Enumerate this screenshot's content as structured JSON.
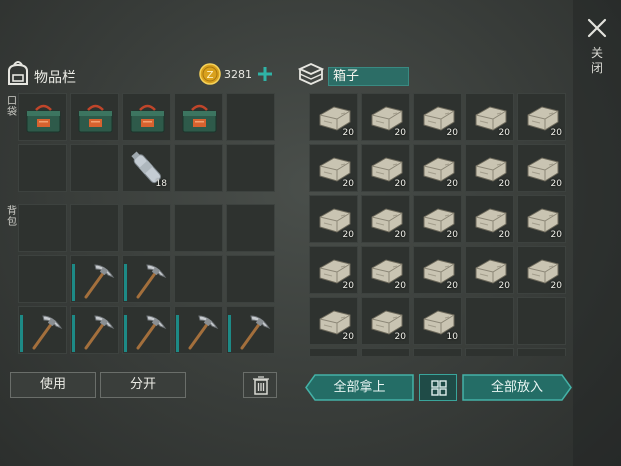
{
  "window": {
    "close_label": "关闭"
  },
  "inventory": {
    "title": "物品栏",
    "coins": "3281",
    "pocket_label": "口袋",
    "backpack_label": "背包",
    "pocket_slots": [
      {
        "item": "military-crate"
      },
      {
        "item": "military-crate"
      },
      {
        "item": "military-crate"
      },
      {
        "item": "military-crate"
      },
      {
        "item": ""
      },
      {
        "item": ""
      },
      {
        "item": ""
      },
      {
        "item": "water-bottle",
        "qty": "18"
      },
      {
        "item": ""
      },
      {
        "item": ""
      }
    ],
    "backpack_slots": [
      {
        "item": ""
      },
      {
        "item": ""
      },
      {
        "item": ""
      },
      {
        "item": ""
      },
      {
        "item": ""
      },
      {
        "item": ""
      },
      {
        "item": "pickaxe",
        "durability": 0.85
      },
      {
        "item": "pickaxe",
        "durability": 0.85
      },
      {
        "item": ""
      },
      {
        "item": ""
      },
      {
        "item": "pickaxe",
        "durability": 0.85
      },
      {
        "item": "pickaxe",
        "durability": 0.85
      },
      {
        "item": "pickaxe",
        "durability": 0.85
      },
      {
        "item": "pickaxe",
        "durability": 0.85
      },
      {
        "item": "pickaxe",
        "durability": 0.85
      }
    ],
    "use_label": "使用",
    "split_label": "分开"
  },
  "box": {
    "title": "箱子",
    "slots": [
      {
        "item": "stone",
        "qty": "20"
      },
      {
        "item": "stone",
        "qty": "20"
      },
      {
        "item": "stone",
        "qty": "20"
      },
      {
        "item": "stone",
        "qty": "20"
      },
      {
        "item": "stone",
        "qty": "20"
      },
      {
        "item": "stone",
        "qty": "20"
      },
      {
        "item": "stone",
        "qty": "20"
      },
      {
        "item": "stone",
        "qty": "20"
      },
      {
        "item": "stone",
        "qty": "20"
      },
      {
        "item": "stone",
        "qty": "20"
      },
      {
        "item": "stone",
        "qty": "20"
      },
      {
        "item": "stone",
        "qty": "20"
      },
      {
        "item": "stone",
        "qty": "20"
      },
      {
        "item": "stone",
        "qty": "20"
      },
      {
        "item": "stone",
        "qty": "20"
      },
      {
        "item": "stone",
        "qty": "20"
      },
      {
        "item": "stone",
        "qty": "20"
      },
      {
        "item": "stone",
        "qty": "20"
      },
      {
        "item": "stone",
        "qty": "20"
      },
      {
        "item": "stone",
        "qty": "20"
      },
      {
        "item": "stone",
        "qty": "20"
      },
      {
        "item": "stone",
        "qty": "20"
      },
      {
        "item": "stone",
        "qty": "10"
      },
      {
        "item": ""
      },
      {
        "item": ""
      },
      {
        "item": ""
      },
      {
        "item": ""
      },
      {
        "item": ""
      },
      {
        "item": ""
      },
      {
        "item": ""
      }
    ],
    "take_all_label": "全部拿上",
    "put_all_label": "全部放入"
  },
  "colors": {
    "accent": "#2c8f86",
    "slot": "#2e322f",
    "durability": "#1d8a86"
  }
}
